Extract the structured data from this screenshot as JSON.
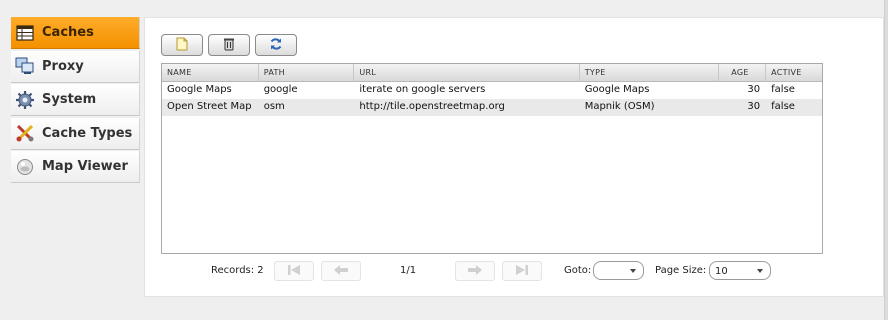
{
  "sidebar": {
    "items": [
      {
        "label": "Caches",
        "icon": "table-icon",
        "active": true
      },
      {
        "label": "Proxy",
        "icon": "proxy-icon",
        "active": false
      },
      {
        "label": "System",
        "icon": "gear-icon",
        "active": false
      },
      {
        "label": "Cache Types",
        "icon": "tools-icon",
        "active": false
      },
      {
        "label": "Map Viewer",
        "icon": "globe-icon",
        "active": false
      }
    ]
  },
  "toolbar": {
    "add": "new-document-icon",
    "delete": "trash-icon",
    "refresh": "refresh-icon"
  },
  "grid": {
    "columns": [
      "NAME",
      "PATH",
      "URL",
      "TYPE",
      "AGE",
      "ACTIVE"
    ],
    "rows": [
      {
        "name": "Google Maps",
        "path": "google",
        "url": "iterate on google servers",
        "type": "Google Maps",
        "age": "30",
        "active": "false"
      },
      {
        "name": "Open Street Map",
        "path": "osm",
        "url": "http://tile.openstreetmap.org",
        "type": "Mapnik (OSM)",
        "age": "30",
        "active": "false"
      }
    ]
  },
  "pager": {
    "records_label": "Records: 2",
    "page_indicator": "1/1",
    "goto_label": "Goto:",
    "goto_value": "",
    "page_size_label": "Page Size:",
    "page_size_value": "10"
  },
  "colors": {
    "active_tab": "#f39100",
    "panel_bg": "#ffffff",
    "body_bg": "#efefef"
  }
}
